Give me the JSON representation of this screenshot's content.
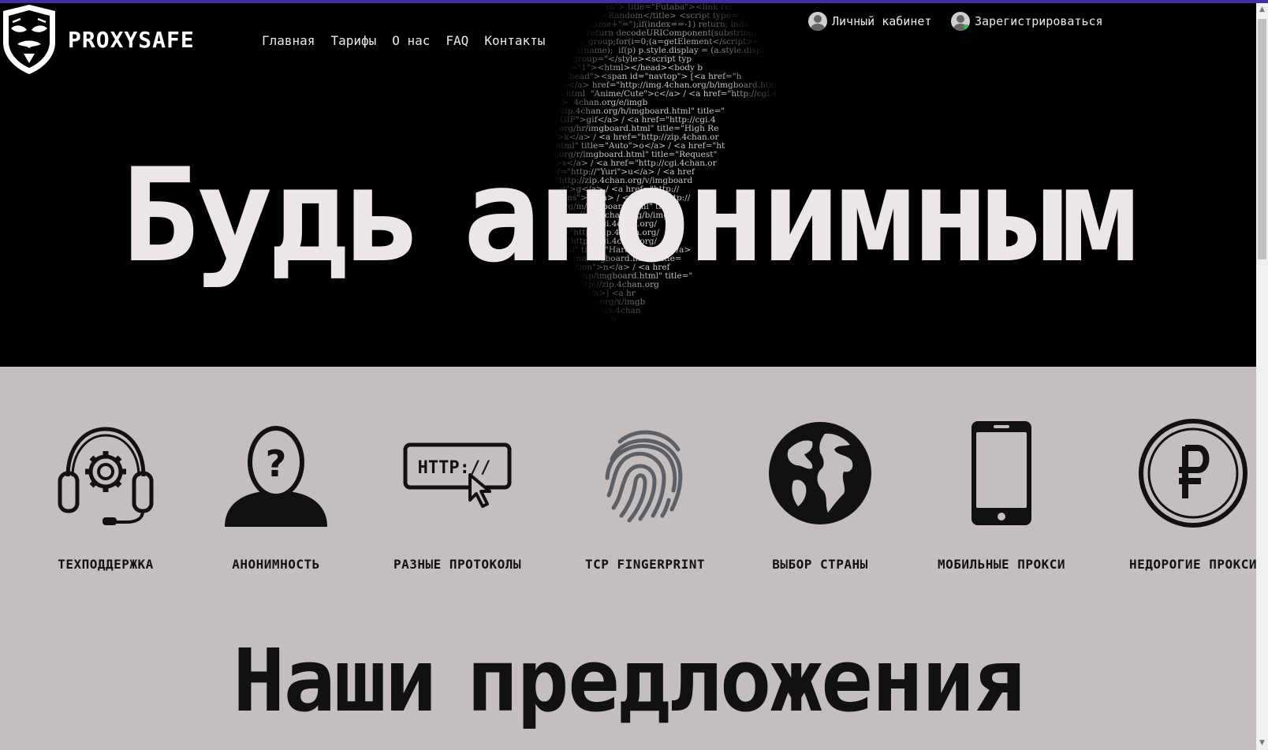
{
  "brand": {
    "name": "PROXYSAFE"
  },
  "nav": [
    "Главная",
    "Тарифы",
    "О нас",
    "FAQ",
    "Контакты"
  ],
  "account": {
    "cabinet": "Личный кабинет",
    "register": "Зарегистрироваться"
  },
  "hero": {
    "title": "Будь анонимным"
  },
  "features": [
    {
      "label": "ТЕХПОДДЕРЖКА",
      "icon": "headset-gear-icon"
    },
    {
      "label": "АНОНИМНОСТЬ",
      "icon": "anonymous-person-icon"
    },
    {
      "label": "РАЗНЫЕ ПРОТОКОЛЫ",
      "icon": "http-protocol-icon"
    },
    {
      "label": "TCP FINGERPRINT",
      "icon": "fingerprint-icon"
    },
    {
      "label": "ВЫБОР СТРАНЫ",
      "icon": "globe-icon"
    },
    {
      "label": "МОБИЛЬНЫЕ ПРОКСИ",
      "icon": "smartphone-icon"
    },
    {
      "label": "НЕДОРОГИЕ ПРОКСИ",
      "icon": "ruble-coin-icon"
    }
  ],
  "offers": {
    "title": "Наши предложения"
  },
  "colors": {
    "hero_bg": "#000000",
    "page_bg": "#c4bebe",
    "hero_text": "#ece6e6",
    "topline": "#3f2fa2"
  }
}
